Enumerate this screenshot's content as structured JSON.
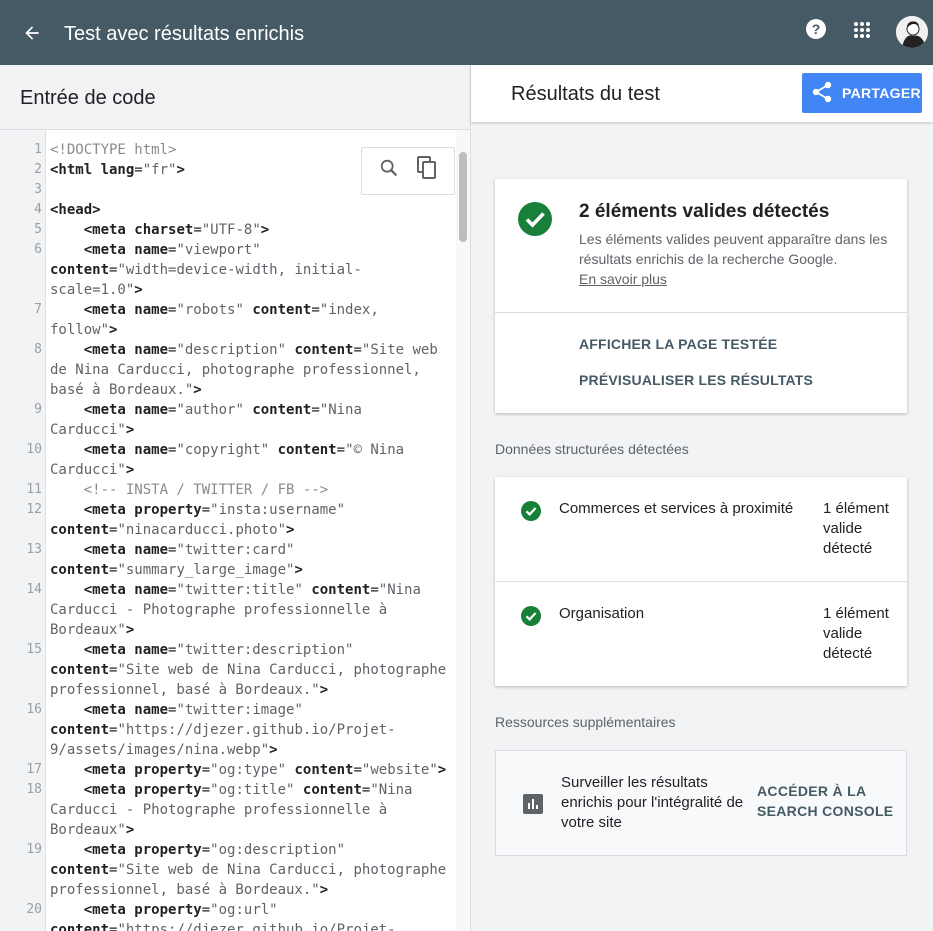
{
  "header": {
    "title": "Test avec résultats enrichis",
    "back_icon": "arrow-back-icon",
    "help_icon": "help-icon",
    "apps_icon": "apps-grid-icon"
  },
  "left_panel": {
    "title": "Entrée de code",
    "tools": [
      "search-icon",
      "copy-icon"
    ],
    "code_lines": [
      {
        "n": "1",
        "rows": [
          [
            [
              "cm",
              "<!DOCTYPE html>"
            ]
          ]
        ]
      },
      {
        "n": "2",
        "rows": [
          [
            [
              "kw",
              "<html "
            ],
            [
              "kw",
              "lang"
            ],
            [
              "",
              "="
            ],
            [
              "str",
              "\"fr\""
            ],
            [
              "kw",
              ">"
            ]
          ]
        ]
      },
      {
        "n": "3",
        "rows": [
          []
        ]
      },
      {
        "n": "4",
        "rows": [
          [
            [
              "kw",
              "<head>"
            ]
          ]
        ]
      },
      {
        "n": "5",
        "rows": [
          [
            [
              "",
              "    "
            ],
            [
              "kw",
              "<meta "
            ],
            [
              "kw",
              "charset"
            ],
            [
              "",
              "="
            ],
            [
              "str",
              "\"UTF-8\""
            ],
            [
              "kw",
              ">"
            ]
          ]
        ]
      },
      {
        "n": "6",
        "rows": [
          [
            [
              "",
              "    "
            ],
            [
              "kw",
              "<meta "
            ],
            [
              "kw",
              "name"
            ],
            [
              "",
              "="
            ],
            [
              "str",
              "\"viewport\""
            ]
          ],
          [
            [
              "kw",
              "content"
            ],
            [
              "",
              "="
            ],
            [
              "str",
              "\"width=device-width, initial-"
            ]
          ],
          [
            [
              "str",
              "scale=1.0\""
            ],
            [
              "kw",
              ">"
            ]
          ]
        ]
      },
      {
        "n": "7",
        "rows": [
          [
            [
              "",
              "    "
            ],
            [
              "kw",
              "<meta "
            ],
            [
              "kw",
              "name"
            ],
            [
              "",
              "="
            ],
            [
              "str",
              "\"robots\" "
            ],
            [
              "kw",
              "content"
            ],
            [
              "",
              "="
            ],
            [
              "str",
              "\"index,"
            ]
          ],
          [
            [
              "str",
              "follow\""
            ],
            [
              "kw",
              ">"
            ]
          ]
        ]
      },
      {
        "n": "8",
        "rows": [
          [
            [
              "",
              "    "
            ],
            [
              "kw",
              "<meta "
            ],
            [
              "kw",
              "name"
            ],
            [
              "",
              "="
            ],
            [
              "str",
              "\"description\" "
            ],
            [
              "kw",
              "content"
            ],
            [
              "",
              "="
            ],
            [
              "str",
              "\"Site web"
            ]
          ],
          [
            [
              "str",
              "de Nina Carducci, photographe professionnel,"
            ]
          ],
          [
            [
              "str",
              "basé à Bordeaux.\""
            ],
            [
              "kw",
              ">"
            ]
          ]
        ]
      },
      {
        "n": "9",
        "rows": [
          [
            [
              "",
              "    "
            ],
            [
              "kw",
              "<meta "
            ],
            [
              "kw",
              "name"
            ],
            [
              "",
              "="
            ],
            [
              "str",
              "\"author\" "
            ],
            [
              "kw",
              "content"
            ],
            [
              "",
              "="
            ],
            [
              "str",
              "\"Nina"
            ]
          ],
          [
            [
              "str",
              "Carducci\""
            ],
            [
              "kw",
              ">"
            ]
          ]
        ]
      },
      {
        "n": "10",
        "rows": [
          [
            [
              "",
              "    "
            ],
            [
              "kw",
              "<meta "
            ],
            [
              "kw",
              "name"
            ],
            [
              "",
              "="
            ],
            [
              "str",
              "\"copyright\" "
            ],
            [
              "kw",
              "content"
            ],
            [
              "",
              "="
            ],
            [
              "str",
              "\"© Nina"
            ]
          ],
          [
            [
              "str",
              "Carducci\""
            ],
            [
              "kw",
              ">"
            ]
          ]
        ]
      },
      {
        "n": "11",
        "rows": [
          [
            [
              "cm",
              "    <!-- INSTA / TWITTER / FB -->"
            ]
          ]
        ]
      },
      {
        "n": "12",
        "rows": [
          [
            [
              "",
              "    "
            ],
            [
              "kw",
              "<meta "
            ],
            [
              "kw",
              "property"
            ],
            [
              "",
              "="
            ],
            [
              "str",
              "\"insta:username\""
            ]
          ],
          [
            [
              "kw",
              "content"
            ],
            [
              "",
              "="
            ],
            [
              "str",
              "\"ninacarducci.photo\""
            ],
            [
              "kw",
              ">"
            ]
          ]
        ]
      },
      {
        "n": "13",
        "rows": [
          [
            [
              "",
              "    "
            ],
            [
              "kw",
              "<meta "
            ],
            [
              "kw",
              "name"
            ],
            [
              "",
              "="
            ],
            [
              "str",
              "\"twitter:card\""
            ]
          ],
          [
            [
              "kw",
              "content"
            ],
            [
              "",
              "="
            ],
            [
              "str",
              "\"summary_large_image\""
            ],
            [
              "kw",
              ">"
            ]
          ]
        ]
      },
      {
        "n": "14",
        "rows": [
          [
            [
              "",
              "    "
            ],
            [
              "kw",
              "<meta "
            ],
            [
              "kw",
              "name"
            ],
            [
              "",
              "="
            ],
            [
              "str",
              "\"twitter:title\" "
            ],
            [
              "kw",
              "content"
            ],
            [
              "",
              "="
            ],
            [
              "str",
              "\"Nina"
            ]
          ],
          [
            [
              "str",
              "Carducci - Photographe professionnelle à"
            ]
          ],
          [
            [
              "str",
              "Bordeaux\""
            ],
            [
              "kw",
              ">"
            ]
          ]
        ]
      },
      {
        "n": "15",
        "rows": [
          [
            [
              "",
              "    "
            ],
            [
              "kw",
              "<meta "
            ],
            [
              "kw",
              "name"
            ],
            [
              "",
              "="
            ],
            [
              "str",
              "\"twitter:description\""
            ]
          ],
          [
            [
              "kw",
              "content"
            ],
            [
              "",
              "="
            ],
            [
              "str",
              "\"Site web de Nina Carducci, photographe"
            ]
          ],
          [
            [
              "str",
              "professionnel, basé à Bordeaux.\""
            ],
            [
              "kw",
              ">"
            ]
          ]
        ]
      },
      {
        "n": "16",
        "rows": [
          [
            [
              "",
              "    "
            ],
            [
              "kw",
              "<meta "
            ],
            [
              "kw",
              "name"
            ],
            [
              "",
              "="
            ],
            [
              "str",
              "\"twitter:image\""
            ]
          ],
          [
            [
              "kw",
              "content"
            ],
            [
              "",
              "="
            ],
            [
              "str",
              "\"https://djezer.github.io/Projet-"
            ]
          ],
          [
            [
              "str",
              "9/assets/images/nina.webp\""
            ],
            [
              "kw",
              ">"
            ]
          ]
        ]
      },
      {
        "n": "17",
        "rows": [
          [
            [
              "",
              "    "
            ],
            [
              "kw",
              "<meta "
            ],
            [
              "kw",
              "property"
            ],
            [
              "",
              "="
            ],
            [
              "str",
              "\"og:type\" "
            ],
            [
              "kw",
              "content"
            ],
            [
              "",
              "="
            ],
            [
              "str",
              "\"website\""
            ],
            [
              "kw",
              ">"
            ]
          ]
        ]
      },
      {
        "n": "18",
        "rows": [
          [
            [
              "",
              "    "
            ],
            [
              "kw",
              "<meta "
            ],
            [
              "kw",
              "property"
            ],
            [
              "",
              "="
            ],
            [
              "str",
              "\"og:title\" "
            ],
            [
              "kw",
              "content"
            ],
            [
              "",
              "="
            ],
            [
              "str",
              "\"Nina"
            ]
          ],
          [
            [
              "str",
              "Carducci - Photographe professionnelle à"
            ]
          ],
          [
            [
              "str",
              "Bordeaux\""
            ],
            [
              "kw",
              ">"
            ]
          ]
        ]
      },
      {
        "n": "19",
        "rows": [
          [
            [
              "",
              "    "
            ],
            [
              "kw",
              "<meta "
            ],
            [
              "kw",
              "property"
            ],
            [
              "",
              "="
            ],
            [
              "str",
              "\"og:description\""
            ]
          ],
          [
            [
              "kw",
              "content"
            ],
            [
              "",
              "="
            ],
            [
              "str",
              "\"Site web de Nina Carducci, photographe"
            ]
          ],
          [
            [
              "str",
              "professionnel, basé à Bordeaux.\""
            ],
            [
              "kw",
              ">"
            ]
          ]
        ]
      },
      {
        "n": "20",
        "rows": [
          [
            [
              "",
              "    "
            ],
            [
              "kw",
              "<meta "
            ],
            [
              "kw",
              "property"
            ],
            [
              "",
              "="
            ],
            [
              "str",
              "\"og:url\""
            ]
          ],
          [
            [
              "kw",
              "content"
            ],
            [
              "",
              "="
            ],
            [
              "str",
              "\"https://djezer.github.io/Projet-"
            ]
          ]
        ]
      }
    ]
  },
  "right_panel": {
    "title": "Résultats du test",
    "share_label": "PARTAGER",
    "summary": {
      "title": "2 éléments valides détectés",
      "desc": "Les éléments valides peuvent apparaître dans les résultats enrichis de la recherche Google.",
      "link": "En savoir plus",
      "action1": "AFFICHER LA PAGE TESTÉE",
      "action2": "PRÉVISUALISER LES RÉSULTATS"
    },
    "structured_title": "Données structurées détectées",
    "structured_items": [
      {
        "name": "Commerces et services à proximité",
        "count": "1 élément valide détecté"
      },
      {
        "name": "Organisation",
        "count": "1 élément valide détecté"
      }
    ],
    "resources_title": "Ressources supplémentaires",
    "resource": {
      "text": "Surveiller les résultats enrichis pour l'intégralité de votre site",
      "link": "ACCÉDER À LA SEARCH CONSOLE"
    },
    "colors": {
      "success": "#188038",
      "primary": "#4285f4",
      "header": "#455a64"
    }
  }
}
